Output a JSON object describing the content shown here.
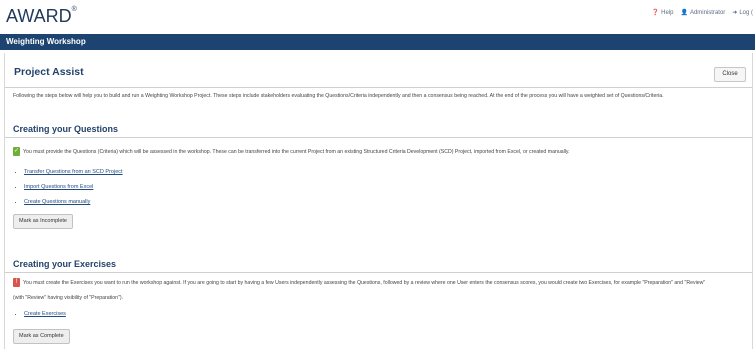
{
  "app": {
    "logo": "AWARD",
    "logo_mark": "®"
  },
  "top_links": {
    "help": "Help",
    "user": "Administrator",
    "logout": "Log ("
  },
  "nav": {
    "title": "Weighting Workshop"
  },
  "project_assist": {
    "title": "Project Assist",
    "close_label": "Close",
    "intro": "Following the steps below will help you to build and run a Weighting Workshop Project. These steps include stakeholders evaluating the Questions/Criteria independently and then a consensus being reached. At the end of the process you will have a weighted set of Questions/Criteria."
  },
  "questions_section": {
    "title": "Creating your Questions",
    "status_text": "You must provide the Questions (Criteria) which will be assessed in the workshop. These can be transferred into the current Project from an existing Structured Criteria Development (SCD) Project, imported from Excel, or created manually.",
    "links": [
      "Transfer Questions from an SCD Project",
      "Import Questions from Excel",
      "Create Questions manually"
    ],
    "button_label": "Mark as Incomplete"
  },
  "exercises_section": {
    "title": "Creating your Exercises",
    "status_line1": "You must create the Exercises you want to run the workshop against. If you are going to start by having a few Users independently assessing the Questions, followed by a review where one User enters the consensus scores, you would create two Exercises, for example \"Preparation\" and \"Review\"",
    "status_line2": "(with \"Review\" having visibility of \"Preparation\").",
    "links": [
      "Create Exercises"
    ],
    "button_label": "Mark as Complete"
  },
  "colors": {
    "brand": "#1d4370",
    "title": "#23436b",
    "ok": "#6fae3b",
    "warn": "#d9534f"
  }
}
